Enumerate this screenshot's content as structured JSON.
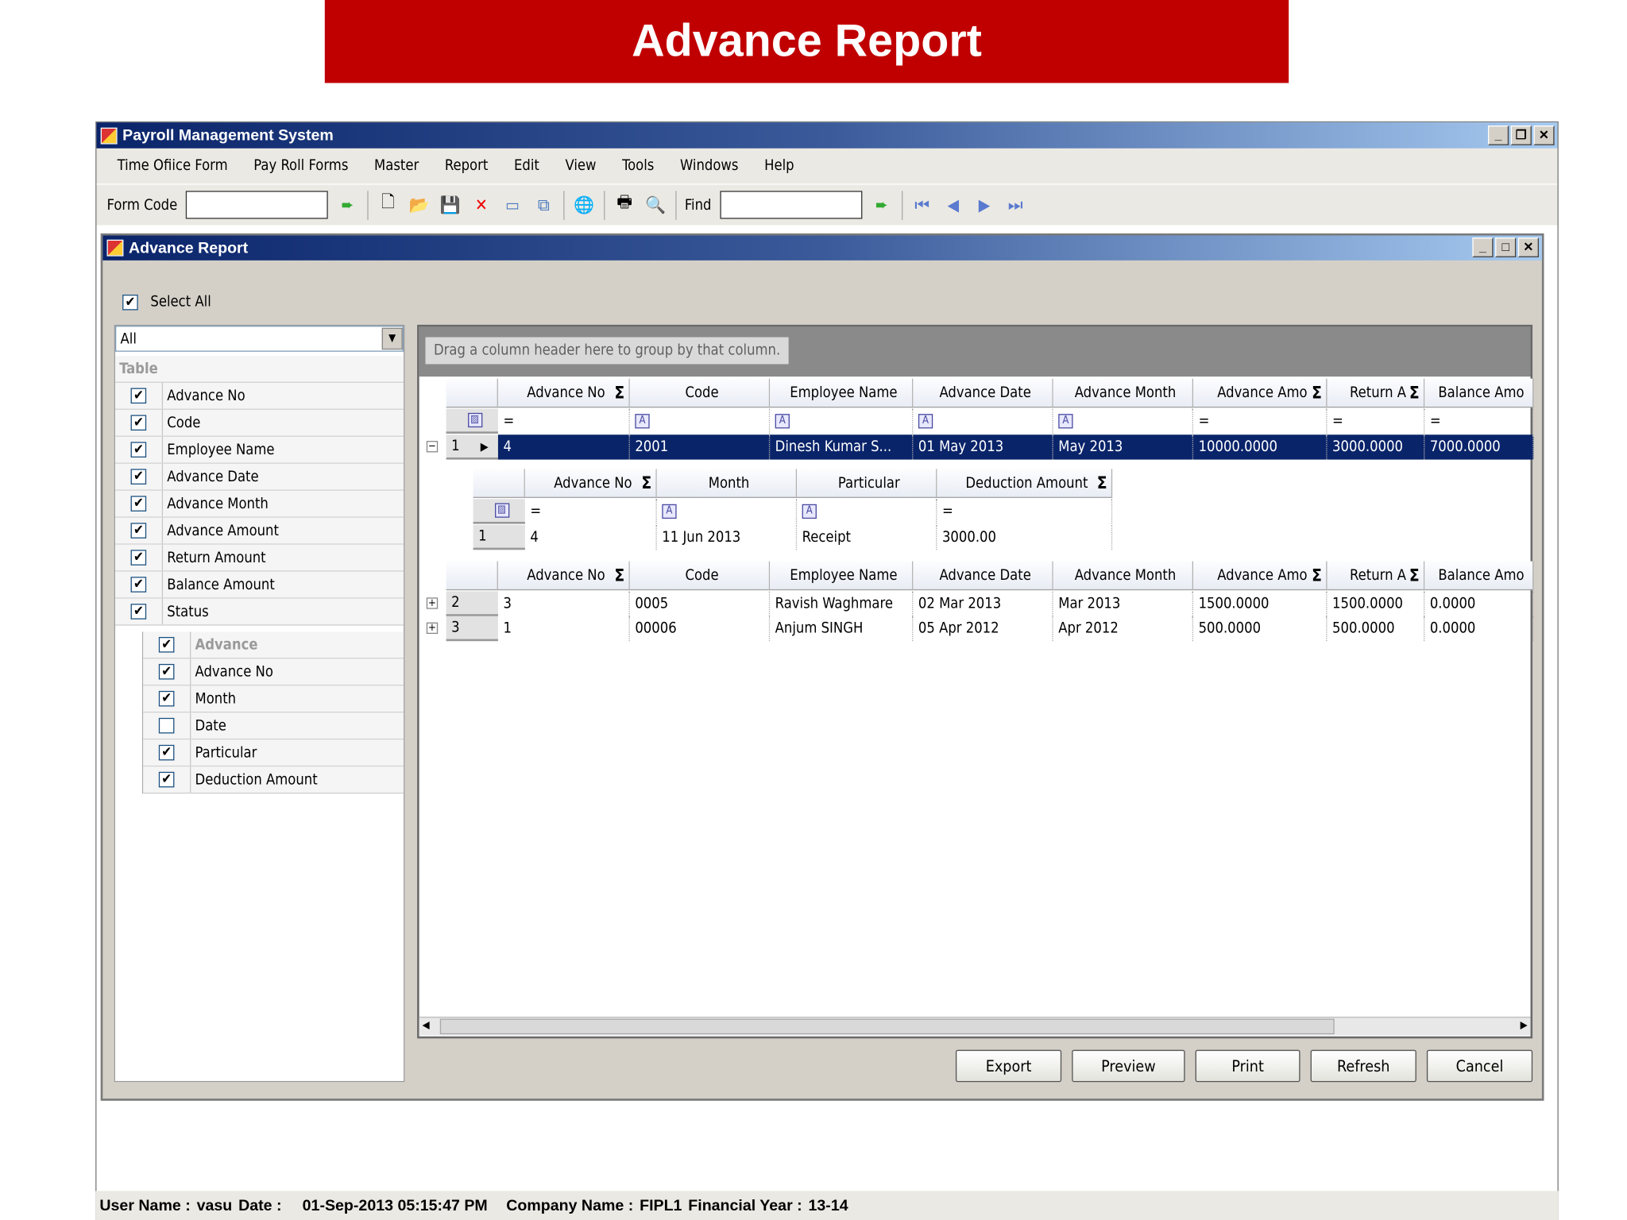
{
  "banner": "Advance Report",
  "app": {
    "title": "Payroll Management System"
  },
  "menu": [
    "Time Ofiice Form",
    "Pay Roll Forms",
    "Master",
    "Report",
    "Edit",
    "View",
    "Tools",
    "Windows",
    "Help"
  ],
  "toolbar": {
    "form_code_label": "Form Code",
    "form_code_value": "",
    "find_label": "Find",
    "find_value": ""
  },
  "child": {
    "title": "Advance Report",
    "select_all": "Select All",
    "dropdown": "All"
  },
  "table_list": {
    "header": "Table",
    "items": [
      {
        "label": "Advance No",
        "checked": true
      },
      {
        "label": "Code",
        "checked": true
      },
      {
        "label": "Employee Name",
        "checked": true
      },
      {
        "label": "Advance Date",
        "checked": true
      },
      {
        "label": "Advance Month",
        "checked": true
      },
      {
        "label": "Advance Amount",
        "checked": true
      },
      {
        "label": "Return Amount",
        "checked": true
      },
      {
        "label": "Balance Amount",
        "checked": true
      },
      {
        "label": "Status",
        "checked": true
      }
    ]
  },
  "advance_list": {
    "header": "Advance",
    "checked": true,
    "items": [
      {
        "label": "Advance No",
        "checked": true
      },
      {
        "label": "Month",
        "checked": true
      },
      {
        "label": "Date",
        "checked": false
      },
      {
        "label": "Particular",
        "checked": true
      },
      {
        "label": "Deduction Amount",
        "checked": true
      }
    ]
  },
  "grid": {
    "group_hint": "Drag a column header here to group by that column.",
    "columns": [
      "Advance No",
      "Code",
      "Employee Name",
      "Advance Date",
      "Advance Month",
      "Advance Amo",
      "Return A",
      "Balance Amo"
    ],
    "rows": [
      {
        "num": "1",
        "cells": [
          "4",
          "2001",
          "Dinesh  Kumar  S...",
          "01 May 2013",
          "May 2013",
          "10000.0000",
          "3000.0000",
          "7000.0000"
        ]
      },
      {
        "num": "2",
        "cells": [
          "3",
          "0005",
          "Ravish Waghmare",
          "02 Mar 2013",
          "Mar 2013",
          "1500.0000",
          "1500.0000",
          "0.0000"
        ]
      },
      {
        "num": "3",
        "cells": [
          "1",
          "00006",
          "Anjum SINGH",
          "05 Apr 2012",
          "Apr 2012",
          "500.0000",
          "500.0000",
          "0.0000"
        ]
      }
    ],
    "detail": {
      "columns": [
        "Advance No",
        "Month",
        "Particular",
        "Deduction Amount"
      ],
      "rows": [
        {
          "num": "1",
          "cells": [
            "4",
            "11 Jun 2013",
            "Receipt",
            "3000.00"
          ]
        }
      ]
    }
  },
  "buttons": {
    "export": "Export",
    "preview": "Preview",
    "print": "Print",
    "refresh": "Refresh",
    "cancel": "Cancel"
  },
  "status": {
    "user_label": "User Name :",
    "user": "vasu",
    "date_label": "Date :",
    "date": "01-Sep-2013 05:15:47 PM",
    "company_label": "Company Name :",
    "company": "FIPL1",
    "fy_label": "Financial Year :",
    "fy": "13-14"
  }
}
